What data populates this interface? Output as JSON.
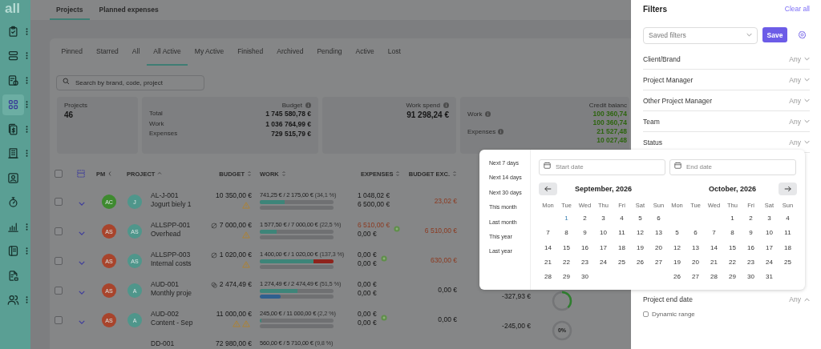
{
  "sidebar": {
    "logo": "all",
    "items": [
      {
        "selected": false,
        "menu": true
      },
      {
        "selected": false,
        "menu": true
      },
      {
        "selected": false,
        "menu": true
      },
      {
        "selected": true,
        "menu": true
      },
      {
        "selected": false,
        "menu": true
      },
      {
        "selected": false,
        "menu": true
      },
      {
        "selected": false,
        "menu": false
      },
      {
        "selected": false,
        "menu": false
      },
      {
        "selected": false,
        "menu": true
      },
      {
        "selected": false,
        "menu": true
      },
      {
        "selected": false,
        "menu": false
      },
      {
        "selected": false,
        "menu": true
      }
    ]
  },
  "top_tabs": [
    {
      "label": "Projects",
      "selected": true
    },
    {
      "label": "Planned expenses",
      "selected": false
    }
  ],
  "filter_tabs": [
    {
      "label": "Pinned",
      "selected": false
    },
    {
      "label": "Starred",
      "selected": false
    },
    {
      "label": "All",
      "selected": false
    },
    {
      "label": "All Active",
      "selected": true
    },
    {
      "label": "My Active",
      "selected": false
    },
    {
      "label": "Finished",
      "selected": false
    },
    {
      "label": "Archived",
      "selected": false
    },
    {
      "label": "Pending",
      "selected": false
    },
    {
      "label": "Active",
      "selected": false
    },
    {
      "label": "Lost",
      "selected": false
    }
  ],
  "search": {
    "placeholder": "Search by brand, code, project"
  },
  "stats": {
    "projects": {
      "label": "Projects",
      "value": "46"
    },
    "budget": {
      "label": "Budget",
      "rows": [
        {
          "label": "Total",
          "value": "1 745 580,78 €"
        },
        {
          "label": "Work",
          "value": "1 036 764,99 €"
        },
        {
          "label": "Expenses",
          "value": "729 515,79 €"
        }
      ]
    },
    "work_spend": {
      "label": "Work spend",
      "value": "91 298,24 €"
    },
    "credit": {
      "label": "Credit balanc",
      "rows": [
        {
          "label": "Work",
          "values": [
            "100 360,74",
            "100 360,74"
          ]
        },
        {
          "label": "Expenses",
          "values": [
            "21 527,48",
            "10 027,48"
          ]
        }
      ]
    }
  },
  "table": {
    "select_all": {
      "checked": false
    },
    "columns": [
      {
        "label": "PM",
        "kind": "left"
      },
      {
        "label": "PROJECT",
        "kind": "up"
      },
      {
        "label": "BUDGET",
        "kind": "both"
      },
      {
        "label": "WORK",
        "kind": "both"
      },
      {
        "label": "EXPENSES",
        "kind": "both"
      },
      {
        "label": "BUDGET EXC.",
        "kind": "both"
      }
    ],
    "rows": [
      {
        "checked": false,
        "pm": {
          "initials": "AC",
          "color": "#3e8a2f"
        },
        "avatar": "J",
        "code": "AL-J-001",
        "name": "Jogurt biely 1",
        "budget": "10 350,00 €",
        "alerts": [
          {
            "kind": "warning"
          }
        ],
        "work_text": "741,25 € / 2 175,00 €",
        "work_pct": "(34,1 %)",
        "work_bar": [
          {
            "level": 0.341,
            "color": "#3d8579"
          }
        ],
        "expense_bar": {
          "level": 0
        },
        "expenses": [
          {
            "text": "1 048,02 €",
            "alert": false
          },
          {
            "text": "6 500,00 €",
            "alert": false
          }
        ],
        "expense_flag": false,
        "budget_exc": {
          "text": "23,02 €",
          "alert": true
        }
      },
      {
        "checked": false,
        "pm": {
          "initials": "AS",
          "color": "#a8442c"
        },
        "avatar": "AS",
        "code": "ALLSPP-001",
        "name": "Overhead",
        "budget_icon": {
          "kind": "crossed"
        },
        "budget": "7 000,00 €",
        "alerts": [
          {
            "kind": "warning"
          }
        ],
        "work_text": "1 577,50 € / 7 000,00 €",
        "work_pct": "(22,5 %)",
        "work_bar": [
          {
            "level": 0.225,
            "color": "#3d8579"
          }
        ],
        "expense_bar": {
          "level": 0
        },
        "expenses": [
          {
            "text": "6 510,00 €",
            "alert": true
          },
          {
            "text": "0,00 €",
            "alert": false
          }
        ],
        "expense_flag": true,
        "budget_exc": {
          "text": "6 510,00 €",
          "alert": true
        }
      },
      {
        "checked": false,
        "pm": {
          "initials": "AS",
          "color": "#a8442c"
        },
        "avatar": "AS",
        "code": "ALLSPP-003",
        "name": "Internal costs",
        "budget_icon": {
          "kind": "crossed"
        },
        "budget": "1 020,00 €",
        "alerts": [
          {
            "kind": "warning"
          }
        ],
        "work_text": "1 400,00 € / 1 020,00 €",
        "work_pct": "(137,3 %)",
        "work_bar": [
          {
            "level": 0.73,
            "color": "#3d8579"
          },
          {
            "level": 0.27,
            "color": "#8e231c"
          }
        ],
        "expense_bar": {
          "level": 0
        },
        "expenses": [
          {
            "text": "0,00 €",
            "alert": false
          },
          {
            "text": "0,00 €",
            "alert": false
          }
        ],
        "expense_flag": true,
        "budget_exc": {
          "text": "630,00 €",
          "alert": true
        }
      },
      {
        "checked": false,
        "pm": {
          "initials": "AS",
          "color": "#a8442c"
        },
        "avatar": "A",
        "code": "AUD-001",
        "name": "Monthly proje",
        "budget_icon": {
          "kind": "coins"
        },
        "budget": "2 474,49 €",
        "work_text": "1 274,49 € / 2 474,49 €",
        "work_pct": "(51,5 %)",
        "work_bar": [
          {
            "level": 0.515,
            "color": "#3d8579"
          }
        ],
        "expense_bar": {
          "level": 0.28
        },
        "expenses": [
          {
            "text": "0,00 €",
            "alert": false
          },
          {
            "text": "0,00 €",
            "alert": false
          }
        ],
        "expense_flag": false,
        "budget_exc": {
          "text": "0,00 €",
          "alert": false
        },
        "balance": "-327,93 €",
        "progress": {
          "level": 0.38
        }
      },
      {
        "checked": false,
        "pm": {
          "initials": "AS",
          "color": "#a8442c"
        },
        "avatar": "A",
        "code": "AUD-002",
        "name": "Content - Sep",
        "budget": "11 000,00 €",
        "alerts": [
          {
            "kind": "warning"
          },
          {
            "kind": "warning"
          }
        ],
        "work_text": "245,00 € / 11 000,00 €",
        "work_pct": "(2,2 %)",
        "work_bar": [
          {
            "level": 0.022,
            "color": "#3d8579"
          }
        ],
        "expense_bar": {
          "level": 0
        },
        "expenses": [
          {
            "text": "0,00 €",
            "alert": false
          },
          {
            "text": "0,00 €",
            "alert": false
          }
        ],
        "expense_flag": true,
        "budget_exc": {
          "text": "0,00 €",
          "alert": false
        },
        "balance": "-245,00 €",
        "progress": {
          "label": "0%",
          "level": 0
        }
      },
      {
        "code": "DD-001",
        "budget": "72 980,00 €",
        "work_text": "560,00 € / 5 710,00 €",
        "work_pct": "(9,8 %)"
      }
    ]
  },
  "filters": {
    "title": "Filters",
    "clear": "Clear all",
    "saved": {
      "placeholder": "Saved filters"
    },
    "save": "Save",
    "items": [
      {
        "label": "Client/Brand",
        "value": "Any",
        "expanded": false
      },
      {
        "label": "Project Manager",
        "value": "Any",
        "expanded": false
      },
      {
        "label": "Other Project Manager",
        "value": "Any",
        "expanded": false
      },
      {
        "label": "Team",
        "value": "Any",
        "expanded": false
      },
      {
        "label": "Status",
        "value": "Any",
        "expanded": false
      }
    ],
    "end_date": {
      "label": "Project end date",
      "value": "Any",
      "expanded": true
    },
    "dynamic_range": {
      "label": "Dynamic range",
      "checked": false
    }
  },
  "date_picker": {
    "presets": [
      "Next 7 days",
      "Next 14 days",
      "Next 30 days",
      "This month",
      "Last month",
      "This year",
      "Last year"
    ],
    "start": {
      "placeholder": "Start date"
    },
    "end": {
      "placeholder": "End date"
    },
    "months": [
      {
        "title": "September, 2026",
        "weekdays": [
          "Mon",
          "Tue",
          "Wed",
          "Thu",
          "Fri",
          "Sat",
          "Sun"
        ],
        "weeks": [
          [
            {
              "label": "1",
              "today": true
            },
            {
              "label": "2",
              "today": false
            },
            {
              "label": "3",
              "today": false
            },
            {
              "label": "4",
              "today": false
            },
            {
              "label": "5",
              "today": false
            },
            {
              "label": "6",
              "today": false
            }
          ],
          [
            {
              "label": "7",
              "today": false
            },
            {
              "label": "8",
              "today": false
            },
            {
              "label": "9",
              "today": false
            },
            {
              "label": "10",
              "today": false
            },
            {
              "label": "11",
              "today": false
            },
            {
              "label": "12",
              "today": false
            },
            {
              "label": "13",
              "today": false
            }
          ],
          [
            {
              "label": "14",
              "today": false
            },
            {
              "label": "15",
              "today": false
            },
            {
              "label": "16",
              "today": false
            },
            {
              "label": "17",
              "today": false
            },
            {
              "label": "18",
              "today": false
            },
            {
              "label": "19",
              "today": false
            },
            {
              "label": "20",
              "today": false
            }
          ],
          [
            {
              "label": "21",
              "today": false
            },
            {
              "label": "22",
              "today": false
            },
            {
              "label": "23",
              "today": false
            },
            {
              "label": "24",
              "today": false
            },
            {
              "label": "25",
              "today": false
            },
            {
              "label": "26",
              "today": false
            },
            {
              "label": "27",
              "today": false
            }
          ],
          [
            {
              "label": "28",
              "today": false
            },
            {
              "label": "29",
              "today": false
            },
            {
              "label": "30",
              "today": false
            }
          ]
        ]
      },
      {
        "title": "October, 2026",
        "weekdays": [
          "Mon",
          "Tue",
          "Wed",
          "Thu",
          "Fri",
          "Sat",
          "Sun"
        ],
        "weeks": [
          [
            {
              "label": "1",
              "today": false
            },
            {
              "label": "2",
              "today": false
            },
            {
              "label": "3",
              "today": false
            },
            {
              "label": "4",
              "today": false
            }
          ],
          [
            {
              "label": "5",
              "today": false
            },
            {
              "label": "6",
              "today": false
            },
            {
              "label": "7",
              "today": false
            },
            {
              "label": "8",
              "today": false
            },
            {
              "label": "9",
              "today": false
            },
            {
              "label": "10",
              "today": false
            },
            {
              "label": "11",
              "today": false
            }
          ],
          [
            {
              "label": "12",
              "today": false
            },
            {
              "label": "13",
              "today": false
            },
            {
              "label": "14",
              "today": false
            },
            {
              "label": "15",
              "today": false
            },
            {
              "label": "16",
              "today": false
            },
            {
              "label": "17",
              "today": false
            },
            {
              "label": "18",
              "today": false
            }
          ],
          [
            {
              "label": "19",
              "today": false
            },
            {
              "label": "20",
              "today": false
            },
            {
              "label": "21",
              "today": false
            },
            {
              "label": "22",
              "today": false
            },
            {
              "label": "23",
              "today": false
            },
            {
              "label": "24",
              "today": false
            },
            {
              "label": "25",
              "today": false
            }
          ],
          [
            {
              "label": "26",
              "today": false
            },
            {
              "label": "27",
              "today": false
            },
            {
              "label": "28",
              "today": false
            },
            {
              "label": "29",
              "today": false
            },
            {
              "label": "30",
              "today": false
            },
            {
              "label": "31",
              "today": false
            }
          ]
        ]
      }
    ]
  }
}
